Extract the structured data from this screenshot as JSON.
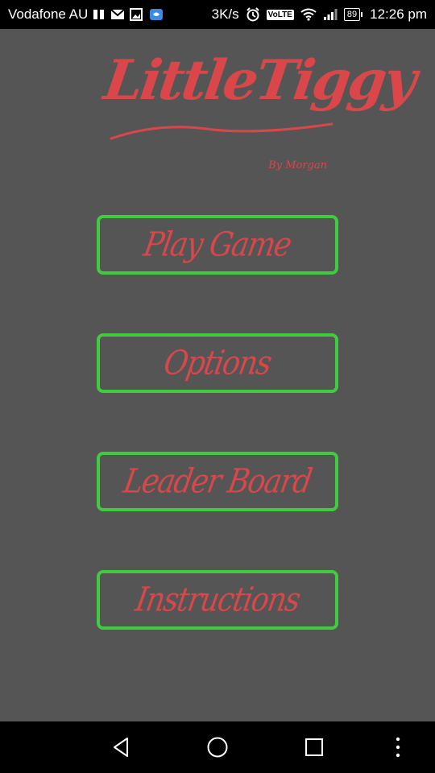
{
  "status_bar": {
    "carrier": "Vodafone AU",
    "network_speed": "3K/s",
    "volte": "VoLTE",
    "battery": "89",
    "time": "12:26 pm"
  },
  "logo": {
    "title": "LittleTiggy",
    "byline": "By Morgan"
  },
  "menu": {
    "play_game": "Play Game",
    "options": "Options",
    "leader_board": "Leader Board",
    "instructions": "Instructions"
  },
  "colors": {
    "background": "#555555",
    "accent_red": "#d9474a",
    "button_border": "#3fcc3f"
  },
  "icons": {
    "nav_back": "triangle-back-icon",
    "nav_home": "circle-home-icon",
    "nav_recents": "square-recents-icon",
    "nav_menu": "vertical-dots-menu-icon"
  }
}
